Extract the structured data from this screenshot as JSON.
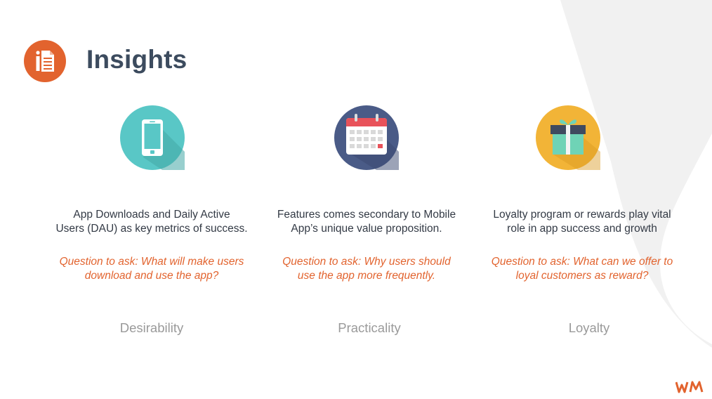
{
  "page": {
    "title": "Insights",
    "brand_color": "#e2632e",
    "title_color": "#3c4b5e"
  },
  "columns": [
    {
      "icon": "smartphone-icon",
      "icon_bg": "#59c7c6",
      "description_line1": "App Downloads and Daily Active",
      "description_line2": "Users (DAU) as key metrics of success.",
      "question_line1": "Question to ask: What will make users",
      "question_line2": "download and use the app?",
      "label": "Desirability"
    },
    {
      "icon": "calendar-icon",
      "icon_bg": "#4a5b87",
      "description_line1": "Features comes secondary to Mobile",
      "description_line2": "App’s unique value proposition.",
      "question_line1": "Question to ask: Why users should",
      "question_line2": "use the app more frequently.",
      "label": "Practicality"
    },
    {
      "icon": "gift-icon",
      "icon_bg": "#f2b437",
      "description_line1": "Loyalty program or rewards play vital",
      "description_line2": "role in app success and growth",
      "question_line1": "Question to ask: What can we offer to",
      "question_line2": "loyal customers as reward?",
      "label": "Loyalty"
    }
  ],
  "logo": {
    "text": "WM"
  }
}
